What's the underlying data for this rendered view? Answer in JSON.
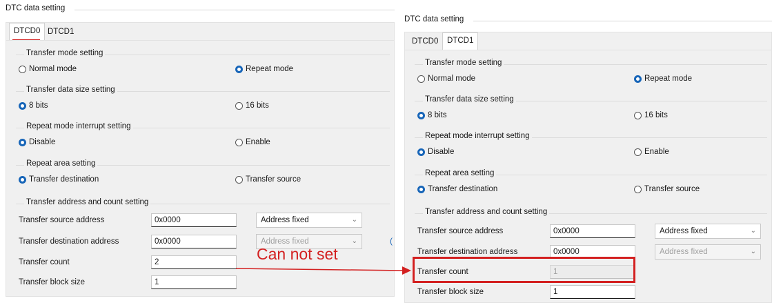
{
  "left": {
    "section_title": "DTC data setting",
    "tabs": [
      "DTCD0",
      "DTCD1"
    ],
    "active_tab": "DTCD0",
    "transfer_mode": {
      "title": "Transfer mode setting",
      "opt1": "Normal mode",
      "opt2": "Repeat mode"
    },
    "data_size": {
      "title": "Transfer data size setting",
      "opt1": "8 bits",
      "opt2": "16 bits"
    },
    "interrupt": {
      "title": "Repeat mode interrupt setting",
      "opt1": "Disable",
      "opt2": "Enable"
    },
    "repeat_area": {
      "title": "Repeat area setting",
      "opt1": "Transfer destination",
      "opt2": "Transfer source"
    },
    "address": {
      "title": "Transfer address and count setting",
      "src_label": "Transfer source address",
      "src_value": "0x0000",
      "src_mode": "Address fixed",
      "dst_label": "Transfer destination address",
      "dst_value": "0x0000",
      "dst_mode": "Address fixed",
      "count_label": "Transfer count",
      "count_value": "2",
      "block_label": "Transfer block size",
      "block_value": "1"
    }
  },
  "right": {
    "section_title": "DTC data setting",
    "tabs": [
      "DTCD0",
      "DTCD1"
    ],
    "active_tab": "DTCD1",
    "transfer_mode": {
      "title": "Transfer mode setting",
      "opt1": "Normal mode",
      "opt2": "Repeat mode"
    },
    "data_size": {
      "title": "Transfer data size setting",
      "opt1": "8 bits",
      "opt2": "16 bits"
    },
    "interrupt": {
      "title": "Repeat mode interrupt setting",
      "opt1": "Disable",
      "opt2": "Enable"
    },
    "repeat_area": {
      "title": "Repeat area setting",
      "opt1": "Transfer destination",
      "opt2": "Transfer source"
    },
    "address": {
      "title": "Transfer address and count setting",
      "src_label": "Transfer source address",
      "src_value": "0x0000",
      "src_mode": "Address fixed",
      "dst_label": "Transfer destination address",
      "dst_value": "0x0000",
      "dst_mode": "Address fixed",
      "count_label": "Transfer count",
      "count_value": "1",
      "block_label": "Transfer block size",
      "block_value": "1"
    }
  },
  "annotation": {
    "text": "Can not set",
    "color": "#d32020"
  },
  "colors": {
    "accent": "#1765b8",
    "highlight": "#d32020"
  }
}
